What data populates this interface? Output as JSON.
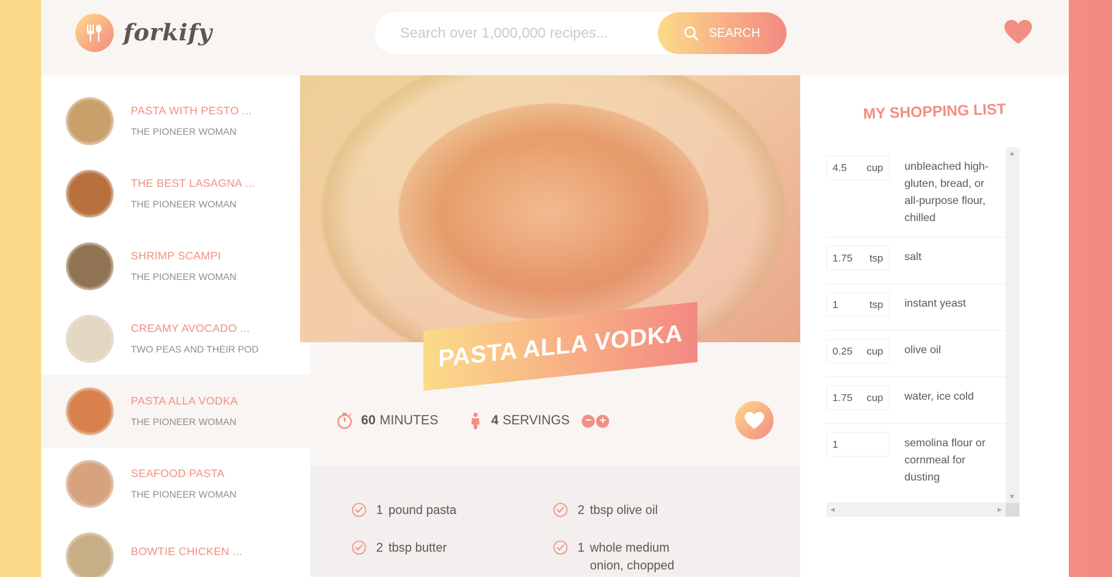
{
  "header": {
    "logo_text": "forkify",
    "search_placeholder": "Search over 1,000,000 recipes...",
    "search_button": "SEARCH",
    "likes_icon": "heart-icon"
  },
  "results": [
    {
      "title": "PASTA WITH PESTO ...",
      "author": "THE PIONEER WOMAN",
      "color": "#c9a06a"
    },
    {
      "title": "THE BEST LASAGNA ...",
      "author": "THE PIONEER WOMAN",
      "color": "#b8703f"
    },
    {
      "title": "SHRIMP SCAMPI",
      "author": "THE PIONEER WOMAN",
      "color": "#8f7352"
    },
    {
      "title": "CREAMY AVOCADO ...",
      "author": "TWO PEAS AND THEIR POD",
      "color": "#e3d7c2"
    },
    {
      "title": "PASTA ALLA VODKA",
      "author": "THE PIONEER WOMAN",
      "color": "#d9804f",
      "active": true
    },
    {
      "title": "SEAFOOD PASTA",
      "author": "THE PIONEER WOMAN",
      "color": "#d7a37f"
    },
    {
      "title": "BOWTIE CHICKEN ...",
      "author": "",
      "color": "#c7ae86"
    }
  ],
  "recipe": {
    "title": "PASTA ALLA VODKA",
    "time_value": "60",
    "time_unit": "MINUTES",
    "servings_value": "4",
    "servings_unit": "SERVINGS",
    "minus_label": "−",
    "plus_label": "+",
    "ingredients": [
      {
        "amount": "1",
        "text": "pound pasta"
      },
      {
        "amount": "2",
        "text": "tbsp olive oil"
      },
      {
        "amount": "2",
        "text": "tbsp butter"
      },
      {
        "amount": "1",
        "text": "whole medium onion, chopped finely"
      }
    ]
  },
  "shopping": {
    "title": "MY SHOPPING LIST",
    "items": [
      {
        "count": "4.5",
        "unit": "cup",
        "desc": "unbleached high-gluten, bread, or all-purpose flour, chilled"
      },
      {
        "count": "1.75",
        "unit": "tsp",
        "desc": "salt"
      },
      {
        "count": "1",
        "unit": "tsp",
        "desc": "instant yeast"
      },
      {
        "count": "0.25",
        "unit": "cup",
        "desc": "olive oil"
      },
      {
        "count": "1.75",
        "unit": "cup",
        "desc": "water, ice cold"
      },
      {
        "count": "1",
        "unit": "",
        "desc": "semolina flour or cornmeal for dusting"
      }
    ]
  },
  "colors": {
    "accent": "#f38e82",
    "gradient_start": "#fbdb89",
    "gradient_end": "#f48982",
    "text": "#615551",
    "light_bg": "#f9f5f3"
  }
}
